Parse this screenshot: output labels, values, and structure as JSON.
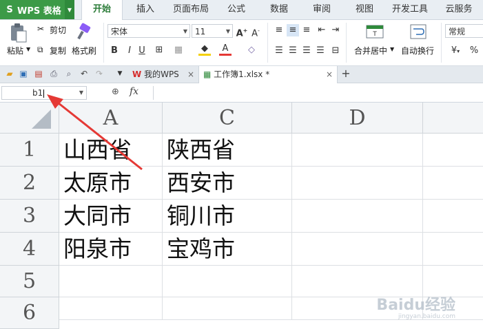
{
  "app": {
    "name": "WPS 表格"
  },
  "tabs": [
    "开始",
    "插入",
    "页面布局",
    "公式",
    "数据",
    "审阅",
    "视图",
    "开发工具",
    "云服务"
  ],
  "ribbon": {
    "paste": "粘贴",
    "cut": "剪切",
    "copy": "复制",
    "format_painter": "格式刷",
    "font_name": "宋体",
    "font_size": "11",
    "merge_center": "合并居中",
    "wrap_text": "自动换行",
    "number_format": "常规",
    "percent": "%"
  },
  "doc_tabs": [
    {
      "label": "我的WPS"
    },
    {
      "label": "工作簿1.xlsx *"
    }
  ],
  "formula_bar": {
    "name_box": "b1",
    "fx": "fx"
  },
  "sheet": {
    "columns": [
      "A",
      "C",
      "D"
    ],
    "rows": [
      "1",
      "2",
      "3",
      "4",
      "5",
      "6"
    ],
    "cells": [
      [
        "山西省",
        "陕西省",
        ""
      ],
      [
        "太原市",
        "西安市",
        ""
      ],
      [
        "大同市",
        "铜川市",
        ""
      ],
      [
        "阳泉市",
        "宝鸡市",
        ""
      ],
      [
        "",
        "",
        ""
      ],
      [
        "",
        "",
        ""
      ]
    ]
  },
  "watermark": {
    "main": "Baidu经验",
    "sub": "jingyan.baidu.com"
  },
  "colors": {
    "accent": "#3c9a47",
    "arrow": "#e53935"
  }
}
